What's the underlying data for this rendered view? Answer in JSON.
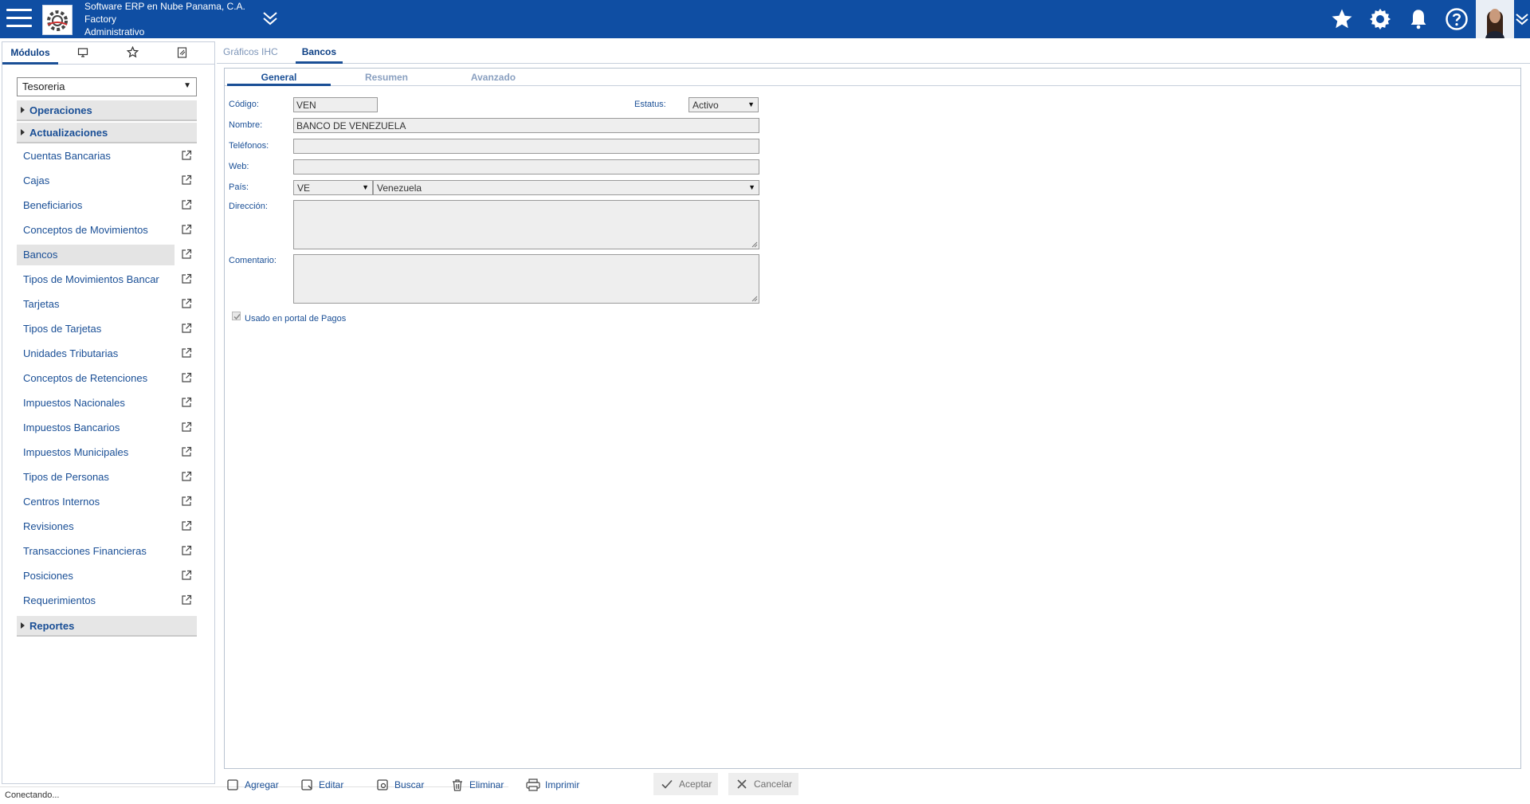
{
  "header": {
    "company_line1": "Software ERP en Nube Panama, C.A.",
    "company_line2": "Factory",
    "company_line3": "Administrativo"
  },
  "left_panel": {
    "tabs": [
      "Módulos",
      "",
      "",
      ""
    ],
    "module_select_value": "Tesoreria",
    "groups": {
      "operaciones": "Operaciones",
      "actualizaciones": "Actualizaciones",
      "reportes": "Reportes"
    },
    "items": [
      {
        "label": "Cuentas Bancarias"
      },
      {
        "label": "Cajas"
      },
      {
        "label": "Beneficiarios"
      },
      {
        "label": "Conceptos de Movimientos"
      },
      {
        "label": "Bancos"
      },
      {
        "label": "Tipos de Movimientos Bancar"
      },
      {
        "label": "Tarjetas"
      },
      {
        "label": "Tipos de Tarjetas"
      },
      {
        "label": "Unidades Tributarias"
      },
      {
        "label": "Conceptos de Retenciones"
      },
      {
        "label": "Impuestos Nacionales"
      },
      {
        "label": "Impuestos Bancarios"
      },
      {
        "label": "Impuestos Municipales"
      },
      {
        "label": "Tipos de Personas"
      },
      {
        "label": "Centros Internos"
      },
      {
        "label": "Revisiones"
      },
      {
        "label": "Transacciones Financieras"
      },
      {
        "label": "Posiciones"
      },
      {
        "label": "Requerimientos"
      }
    ],
    "active_item": "Bancos"
  },
  "status_bar": "Conectando...",
  "main": {
    "tabs": [
      "Gráficos IHC",
      "Bancos"
    ],
    "active_tab": "Bancos",
    "sub_tabs": [
      "General",
      "Resumen",
      "Avanzado"
    ],
    "active_sub_tab": "General",
    "form": {
      "codigo_label": "Código:",
      "codigo_value": "VEN",
      "estatus_label": "Estatus:",
      "estatus_value": "Activo",
      "nombre_label": "Nombre:",
      "nombre_value": "BANCO DE VENEZUELA",
      "telefonos_label": "Teléfonos:",
      "telefonos_value": "",
      "web_label": "Web:",
      "web_value": "",
      "pais_label": "País:",
      "pais_code": "VE",
      "pais_name": "Venezuela",
      "direccion_label": "Dirección:",
      "comentario_label": "Comentario:",
      "portal_label": "Usado en portal de Pagos",
      "portal_checked": true
    }
  },
  "toolbar": {
    "agregar": "Agregar",
    "editar": "Editar",
    "buscar": "Buscar",
    "eliminar": "Eliminar",
    "imprimir": "Imprimir",
    "aceptar": "Aceptar",
    "cancelar": "Cancelar"
  },
  "colors": {
    "topbar": "#0f4ea3",
    "text_link": "#1a4f96",
    "field_bg": "#eeeeee"
  },
  "icons": [
    "menu-icon",
    "company-logo",
    "collapse-chevron-icon",
    "star-icon",
    "gear-icon",
    "bell-icon",
    "help-icon",
    "monitor-icon",
    "star-outline-icon",
    "document-icon",
    "external-link-icon",
    "add-icon",
    "edit-icon",
    "search-icon",
    "trash-icon",
    "print-icon",
    "check-icon",
    "close-icon"
  ]
}
